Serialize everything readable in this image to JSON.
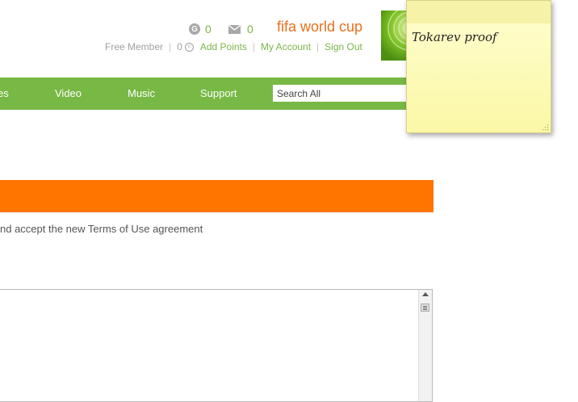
{
  "header": {
    "points_icon_label": "G",
    "points_count": "0",
    "messages_count": "0",
    "username": "fifa world cup",
    "member_type": "Free Member",
    "points_balance": "0",
    "add_points": "Add Points",
    "my_account": "My Account",
    "sign_out": "Sign Out"
  },
  "nav": {
    "items": [
      "es",
      "Video",
      "Music",
      "Support"
    ],
    "search_placeholder": "Search All"
  },
  "main": {
    "terms_text": "nd accept the new Terms of Use agreement"
  },
  "sticky_note": {
    "text": "Tokarev proof"
  },
  "colors": {
    "accent_green": "#78b845",
    "banner_orange": "#ff7500",
    "username_orange": "#e8701c",
    "sticky_yellow": "#fcf9b0"
  }
}
